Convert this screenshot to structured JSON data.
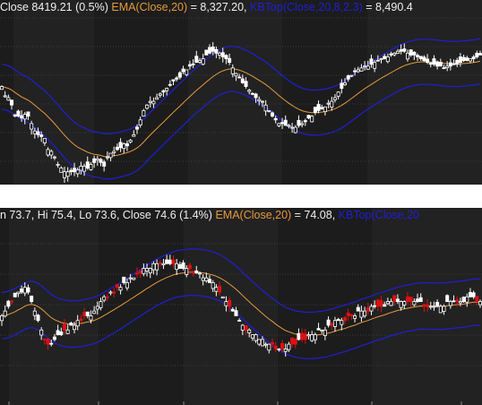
{
  "colors": {
    "background": "#111111",
    "band_dark": "#1c1c1c",
    "band_light": "#222222",
    "grid": "#3a3a3a",
    "legend_text": "#f0f0f0",
    "ema": "#e69a3c",
    "keltner": "#1f1fd6",
    "candle_up": "#ffffff",
    "candle_down": "#dd1111"
  },
  "panels": [
    {
      "legend": {
        "price_text": "Close 8419.21 (0.5%) ",
        "ema_text": "EMA(Close,20)",
        "ema_value": " = 8,327.20, ",
        "kb_text": "KBTop(Close,20,8,2.3)",
        "kb_value": " = 8,490.4"
      },
      "chart_data": {
        "type": "candlestick",
        "indicators": [
          "EMA(Close,20)",
          "KBTop(Close,20,8,2.3)"
        ],
        "ylim": [
          66,
          153
        ],
        "closes": [
          116,
          111,
          110,
          106,
          100,
          100,
          99,
          101,
          100,
          96,
          92,
          90,
          89,
          88,
          82,
          81,
          78,
          74,
          72,
          70,
          70,
          70,
          70,
          71,
          73,
          73,
          72,
          74,
          75,
          77,
          75,
          73,
          78,
          80,
          81,
          82,
          83,
          85,
          84,
          87,
          90,
          93,
          98,
          103,
          106,
          108,
          108,
          110,
          112,
          113,
          115,
          117,
          119,
          120,
          121,
          124,
          125,
          127,
          128,
          129,
          130,
          131,
          133,
          134,
          135,
          134,
          134,
          132,
          131,
          129,
          126,
          123,
          121,
          118,
          116,
          114,
          112,
          110,
          109,
          108,
          106,
          103,
          100,
          98,
          96,
          96,
          95,
          95,
          94,
          94,
          95,
          96,
          97,
          99,
          100,
          102,
          103,
          104,
          105,
          107,
          108,
          110,
          113,
          115,
          118,
          120,
          122,
          124,
          125,
          126,
          127,
          127,
          128,
          129,
          130,
          131,
          131,
          132,
          133,
          134,
          135,
          135,
          135,
          134,
          133,
          133,
          132,
          131,
          130,
          129,
          128,
          128,
          127,
          127,
          126,
          127,
          127,
          128,
          128,
          129,
          130,
          130,
          131,
          131,
          132,
          133
        ]
      }
    },
    {
      "legend": {
        "price_text": "n 73.7, Hi 75.4, Lo 73.6, Close 74.6 (1.4%) ",
        "ema_text": "EMA(Close,20)",
        "ema_value": " = 74.08, ",
        "kb_text": "KBTop(Close,20"
      },
      "chart_data": {
        "type": "candlestick",
        "indicators": [
          "EMA(Close,20)",
          "KBTop(Close,20)"
        ],
        "ylim": [
          55,
          90
        ],
        "closes": [
          71,
          72,
          73,
          74,
          75,
          76,
          76,
          77,
          76,
          74,
          72,
          70,
          68,
          66,
          65,
          65,
          66,
          67,
          67,
          68,
          68,
          69,
          69,
          70,
          70,
          71,
          71,
          71,
          72,
          73,
          74,
          75,
          75,
          76,
          76,
          77,
          77,
          78,
          78,
          79,
          79,
          80,
          80,
          81,
          81,
          81,
          82,
          82,
          82,
          82,
          82,
          82,
          82,
          82,
          81,
          81,
          81,
          81,
          80,
          80,
          80,
          79,
          79,
          78,
          78,
          77,
          76,
          75,
          74,
          73,
          72,
          71,
          70,
          69,
          68,
          68,
          67,
          67,
          66,
          66,
          65,
          65,
          65,
          64,
          64,
          64,
          64,
          65,
          65,
          65,
          66,
          66,
          66,
          67,
          67,
          67,
          68,
          68,
          68,
          69,
          69,
          70,
          70,
          70,
          70,
          71,
          71,
          71,
          72,
          72,
          72,
          72,
          73,
          73,
          73,
          73,
          73,
          74,
          74,
          74,
          74,
          74,
          74,
          74,
          74,
          74,
          74,
          74,
          73,
          73,
          73,
          73,
          73,
          73,
          73,
          74,
          74,
          74,
          74,
          74,
          74,
          75,
          75,
          75,
          74,
          74
        ]
      }
    }
  ]
}
